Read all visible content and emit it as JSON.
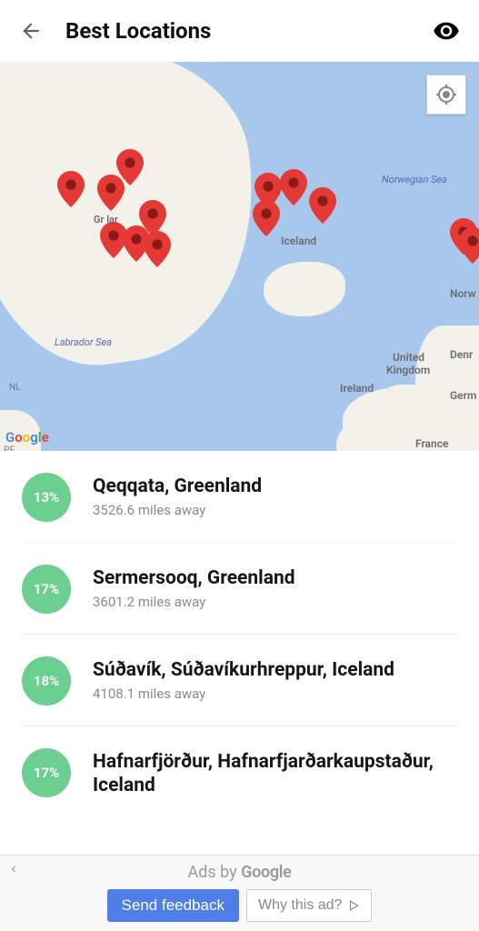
{
  "header": {
    "title": "Best Locations"
  },
  "map": {
    "labels": {
      "norwegian_sea": "Norwegian Sea",
      "labrador_sea": "Labrador Sea",
      "iceland": "Iceland",
      "norway": "Norw",
      "denmark": "Denr",
      "uk1": "United",
      "uk2": "Kingdom",
      "ireland": "Ireland",
      "germany": "Germ",
      "france": "France",
      "nl": "NL",
      "pe": "PE",
      "greenland": "Gr      lar"
    },
    "attribution": "Google"
  },
  "locations": [
    {
      "pct": "13%",
      "name": "Qeqqata, Greenland",
      "distance": "3526.6 miles away"
    },
    {
      "pct": "17%",
      "name": "Sermersooq, Greenland",
      "distance": "3601.2 miles away"
    },
    {
      "pct": "18%",
      "name": "Súðavík, Súðavíkurhreppur, Iceland",
      "distance": "4108.1 miles away"
    },
    {
      "pct": "17%",
      "name": "Hafnarfjörður, Hafnarfjarðarkaupstaður, Iceland",
      "distance": ""
    }
  ],
  "ad": {
    "byline_prefix": "Ads by ",
    "byline_brand": "Google",
    "feedback": "Send feedback",
    "why": "Why this ad?"
  }
}
